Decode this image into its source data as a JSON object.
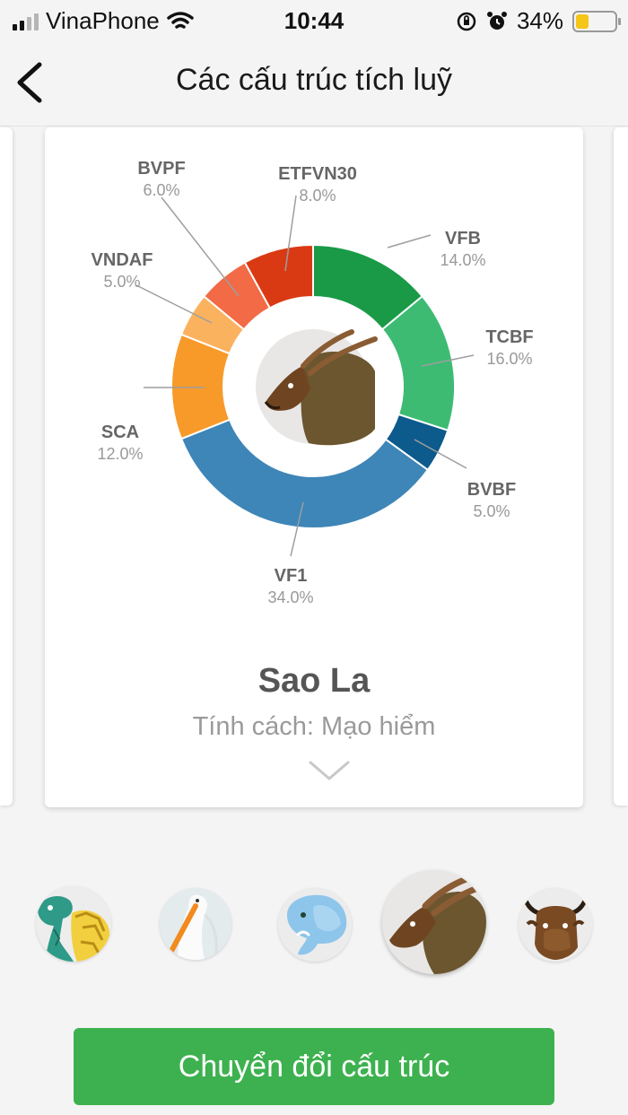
{
  "status_bar": {
    "carrier": "VinaPhone",
    "time": "10:44",
    "battery_percent": "34%",
    "battery_level": 0.34,
    "icons": [
      "signal-icon",
      "wifi-icon",
      "orientation-lock-icon",
      "alarm-icon",
      "battery-icon"
    ]
  },
  "header": {
    "title": "Các cấu trúc tích luỹ",
    "back_icon": "chevron-left-icon"
  },
  "card": {
    "name": "Sao La",
    "personality": "Tính cách: Mạo hiểm",
    "expand_icon": "chevron-down-icon",
    "center_image": "saola-avatar"
  },
  "chart_data": {
    "type": "pie",
    "variant": "donut",
    "slices": [
      {
        "label": "VFB",
        "value": 14.0,
        "display": "14.0%",
        "color": "#1a9a47"
      },
      {
        "label": "TCBF",
        "value": 16.0,
        "display": "16.0%",
        "color": "#3dbb73"
      },
      {
        "label": "BVBF",
        "value": 5.0,
        "display": "5.0%",
        "color": "#0d5a8c"
      },
      {
        "label": "VF1",
        "value": 34.0,
        "display": "34.0%",
        "color": "#3e85b8"
      },
      {
        "label": "SCA",
        "value": 12.0,
        "display": "12.0%",
        "color": "#f79a2a"
      },
      {
        "label": "VNDAF",
        "value": 5.0,
        "display": "5.0%",
        "color": "#fbb25e"
      },
      {
        "label": "BVPF",
        "value": 6.0,
        "display": "6.0%",
        "color": "#f26a46"
      },
      {
        "label": "ETFVN30",
        "value": 8.0,
        "display": "8.0%",
        "color": "#d93a14"
      }
    ]
  },
  "avatars": [
    {
      "name": "turtle",
      "selected": false
    },
    {
      "name": "stork",
      "selected": false
    },
    {
      "name": "elephant",
      "selected": false
    },
    {
      "name": "saola",
      "selected": true
    },
    {
      "name": "buffalo",
      "selected": false
    }
  ],
  "cta": {
    "label": "Chuyển đổi cấu trúc"
  },
  "colors": {
    "accent": "#3db14f",
    "background": "#f4f4f4"
  }
}
